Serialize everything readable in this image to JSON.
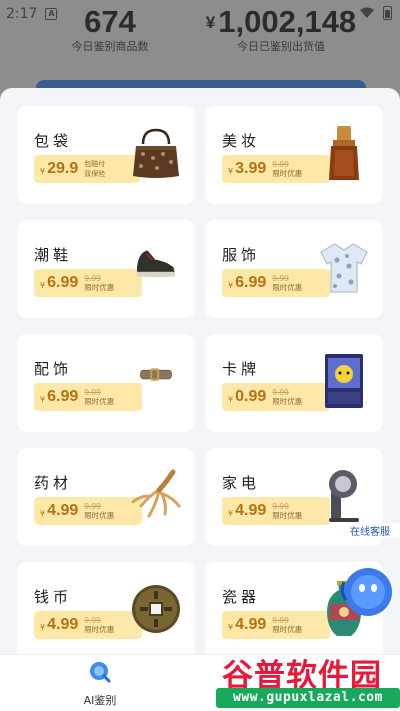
{
  "status": {
    "time": "2:17",
    "notif_icon": "A"
  },
  "stats": {
    "items_count": "674",
    "items_label": "今日鉴别商品数",
    "currency": "¥",
    "value": "1,002,148",
    "value_label": "今日已鉴别出货值"
  },
  "categories": [
    {
      "title": "包袋",
      "price": "29.9",
      "line1": "包赔付",
      "line2": "双保险",
      "icon": "handbag-icon"
    },
    {
      "title": "美妆",
      "price": "3.99",
      "old": "9.99",
      "promo": "限时优惠",
      "icon": "serum-bottle-icon"
    },
    {
      "title": "潮鞋",
      "price": "6.99",
      "old": "9.99",
      "promo": "限时优惠",
      "icon": "sneaker-icon"
    },
    {
      "title": "服饰",
      "price": "6.99",
      "old": "9.99",
      "promo": "限时优惠",
      "icon": "shirt-icon"
    },
    {
      "title": "配饰",
      "price": "6.99",
      "old": "9.99",
      "promo": "限时优惠",
      "icon": "belt-icon"
    },
    {
      "title": "卡牌",
      "price": "0.99",
      "old": "9.99",
      "promo": "限时优惠",
      "icon": "trading-card-icon"
    },
    {
      "title": "药材",
      "price": "4.99",
      "old": "9.99",
      "promo": "限时优惠",
      "icon": "ginseng-icon"
    },
    {
      "title": "家电",
      "price": "4.99",
      "old": "9.99",
      "promo": "限时优惠",
      "icon": "hair-dryer-icon"
    },
    {
      "title": "钱币",
      "price": "4.99",
      "old": "9.99",
      "promo": "限时优惠",
      "icon": "coin-icon"
    },
    {
      "title": "瓷器",
      "price": "4.99",
      "old": "9.99",
      "promo": "限时优惠",
      "icon": "vase-icon"
    }
  ],
  "currency_small": "¥",
  "bottom_nav": {
    "label": "AI鉴别",
    "icon": "search-icon"
  },
  "customer_service": {
    "label": "在线客服",
    "icon": "chat-bot-icon"
  },
  "watermark": {
    "line1": "谷普软件园",
    "line2": "www.gupuxlazal.com"
  },
  "colors": {
    "price_tag": "#fde8a8",
    "price_text": "#b57213",
    "sheet_bg": "#f3f4f7",
    "card_bg": "#ffffff",
    "accent_blue": "#1e57c5"
  }
}
